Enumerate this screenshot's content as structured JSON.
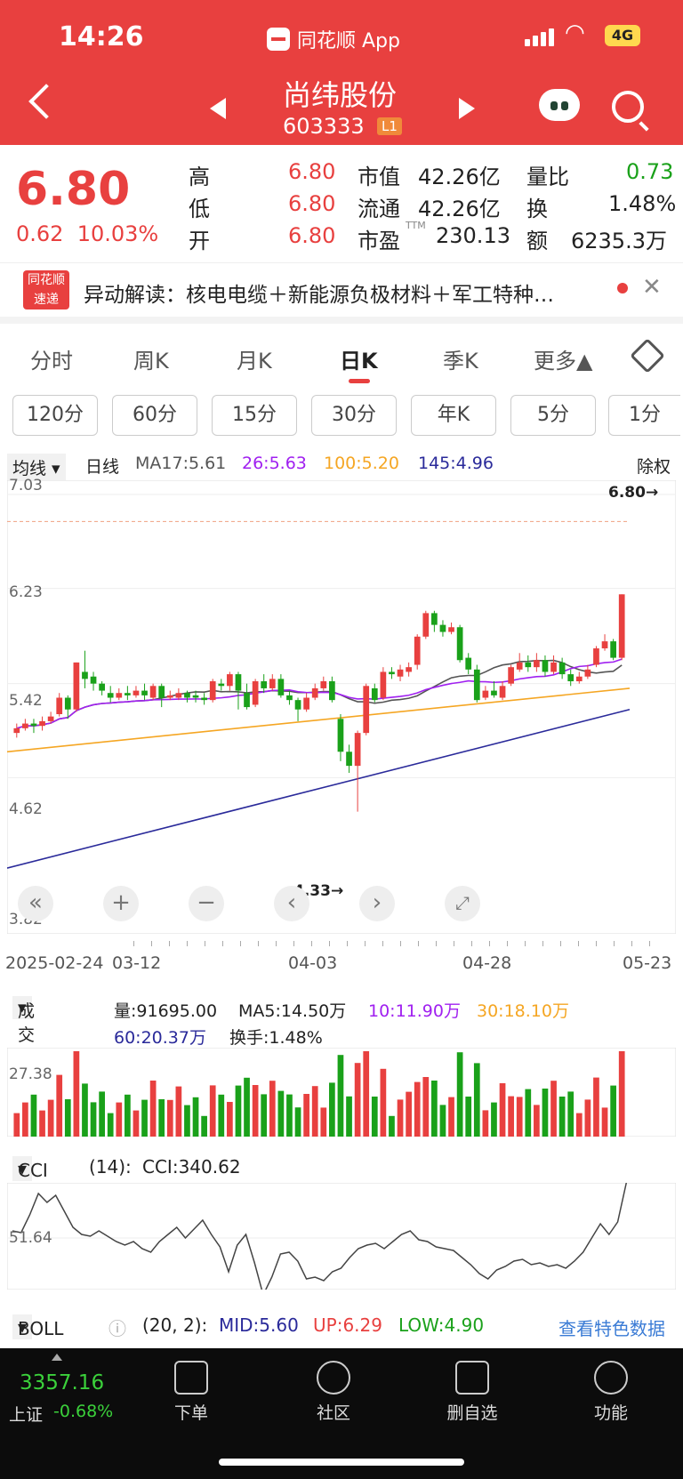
{
  "status": {
    "time": "14:26",
    "app": "同花顺 App",
    "battery": "4G"
  },
  "header": {
    "name": "尚纬股份",
    "code": "603333",
    "badge": "L1"
  },
  "quote": {
    "price": "6.80",
    "chg": "0.62",
    "chgPct": "10.03%",
    "rows": [
      {
        "l1": "高",
        "v1": "6.80",
        "l2": "市值",
        "v2": "42.26亿",
        "l3": "量比",
        "v3": "0.73"
      },
      {
        "l1": "低",
        "v1": "6.80",
        "l2": "流通",
        "v2": "42.26亿",
        "l3": "换",
        "v3": "1.48%"
      },
      {
        "l1": "开",
        "v1": "6.80",
        "l2": "市盈",
        "v2": "230.13",
        "l3": "额",
        "v3": "6235.3万"
      }
    ],
    "ttm": "TTM"
  },
  "news": {
    "logo1": "同花顺",
    "logo2": "速递",
    "text": "异动解读：核电电缆＋新能源负极材料＋军工特种…"
  },
  "tabs": [
    "分时",
    "周K",
    "月K",
    "日K",
    "季K",
    "更多▲"
  ],
  "intervals": [
    "120分",
    "60分",
    "15分",
    "30分",
    "年K",
    "5分",
    "1分"
  ],
  "ma": {
    "select": "均线",
    "type": "日线",
    "ma17": "MA17:5.61",
    "ma26": "26:5.63",
    "ma100": "100:5.20",
    "ma145": "145:4.96",
    "adjust": "除权"
  },
  "kchart": {
    "yTicks": [
      "7.03",
      "6.23",
      "5.42",
      "4.62",
      "3.82"
    ],
    "high": "6.80→",
    "low": "4.33→",
    "dates": [
      "2025-02-24",
      "03-12",
      "04-03",
      "04-28",
      "05-23"
    ]
  },
  "volume": {
    "select": "成交量",
    "vol": "量:91695.00",
    "ma5": "MA5:14.50万",
    "ma10": "10:11.90万",
    "ma30": "30:18.10万",
    "ma60": "60:20.37万",
    "turn": "换手:1.48%",
    "tick": "27.38"
  },
  "cci": {
    "select": "CCI",
    "param": "(14):",
    "value": "CCI:340.62",
    "tick": "51.64"
  },
  "boll": {
    "select": "BOLL",
    "param": "(20, 2):",
    "mid": "MID:5.60",
    "up": "UP:6.29",
    "low": "LOW:4.90",
    "link": "查看特色数据"
  },
  "bottom": {
    "index": "3357.16",
    "indexName": "上证",
    "indexChg": "-0.68%",
    "nav": [
      "下单",
      "社区",
      "删自选",
      "功能"
    ]
  },
  "colors": {
    "red": "#e8403f",
    "green": "#1aa11a",
    "purple": "#a020f0",
    "orange": "#f5a623",
    "navy": "#2a2a9a",
    "gray": "#555"
  },
  "chart_data": {
    "type": "candlestick",
    "ylim": [
      3.82,
      7.03
    ],
    "candles": [
      [
        5.0,
        5.04,
        4.96,
        5.08
      ],
      [
        5.04,
        5.08,
        5.02,
        5.12
      ],
      [
        5.08,
        5.06,
        5.0,
        5.12
      ],
      [
        5.06,
        5.1,
        5.02,
        5.14
      ],
      [
        5.1,
        5.14,
        5.08,
        5.18
      ],
      [
        5.16,
        5.3,
        5.14,
        5.34
      ],
      [
        5.3,
        5.2,
        5.12,
        5.32
      ],
      [
        5.2,
        5.6,
        5.18,
        5.6
      ],
      [
        5.52,
        5.46,
        5.38,
        5.7
      ],
      [
        5.48,
        5.42,
        5.36,
        5.52
      ],
      [
        5.42,
        5.36,
        5.32,
        5.44
      ],
      [
        5.34,
        5.3,
        5.26,
        5.4
      ],
      [
        5.3,
        5.34,
        5.28,
        5.38
      ],
      [
        5.34,
        5.32,
        5.28,
        5.4
      ],
      [
        5.32,
        5.36,
        5.3,
        5.4
      ],
      [
        5.36,
        5.32,
        5.28,
        5.42
      ],
      [
        5.3,
        5.4,
        5.28,
        5.42
      ],
      [
        5.4,
        5.3,
        5.22,
        5.42
      ],
      [
        5.3,
        5.32,
        5.28,
        5.36
      ],
      [
        5.3,
        5.34,
        5.28,
        5.38
      ],
      [
        5.34,
        5.3,
        5.26,
        5.36
      ],
      [
        5.32,
        5.3,
        5.26,
        5.36
      ],
      [
        5.3,
        5.28,
        5.24,
        5.34
      ],
      [
        5.28,
        5.44,
        5.26,
        5.46
      ],
      [
        5.42,
        5.4,
        5.36,
        5.46
      ],
      [
        5.4,
        5.5,
        5.36,
        5.52
      ],
      [
        5.5,
        5.36,
        5.2,
        5.52
      ],
      [
        5.34,
        5.22,
        5.2,
        5.42
      ],
      [
        5.24,
        5.44,
        5.22,
        5.46
      ],
      [
        5.44,
        5.38,
        5.34,
        5.5
      ],
      [
        5.38,
        5.46,
        5.36,
        5.5
      ],
      [
        5.46,
        5.32,
        5.3,
        5.5
      ],
      [
        5.32,
        5.28,
        5.24,
        5.36
      ],
      [
        5.28,
        5.2,
        5.1,
        5.3
      ],
      [
        5.2,
        5.3,
        5.18,
        5.34
      ],
      [
        5.3,
        5.38,
        5.28,
        5.42
      ],
      [
        5.38,
        5.44,
        5.36,
        5.48
      ],
      [
        5.44,
        5.28,
        5.26,
        5.48
      ],
      [
        5.12,
        4.84,
        4.76,
        5.16
      ],
      [
        4.84,
        4.72,
        4.66,
        4.9
      ],
      [
        4.72,
        5.0,
        4.33,
        5.02
      ],
      [
        5.0,
        5.4,
        4.98,
        5.42
      ],
      [
        5.38,
        5.28,
        5.26,
        5.42
      ],
      [
        5.3,
        5.52,
        5.28,
        5.56
      ],
      [
        5.52,
        5.5,
        5.46,
        5.56
      ],
      [
        5.48,
        5.54,
        5.44,
        5.58
      ],
      [
        5.52,
        5.56,
        5.48,
        5.6
      ],
      [
        5.58,
        5.82,
        5.54,
        5.84
      ],
      [
        5.82,
        6.02,
        5.8,
        6.04
      ],
      [
        6.02,
        5.92,
        5.86,
        6.04
      ],
      [
        5.92,
        5.86,
        5.82,
        5.96
      ],
      [
        5.86,
        5.9,
        5.84,
        5.94
      ],
      [
        5.9,
        5.62,
        5.6,
        5.92
      ],
      [
        5.64,
        5.54,
        5.5,
        5.68
      ],
      [
        5.54,
        5.28,
        5.26,
        5.58
      ],
      [
        5.3,
        5.36,
        5.28,
        5.4
      ],
      [
        5.36,
        5.32,
        5.3,
        5.44
      ],
      [
        5.3,
        5.4,
        5.28,
        5.44
      ],
      [
        5.42,
        5.56,
        5.4,
        5.58
      ],
      [
        5.54,
        5.6,
        5.52,
        5.68
      ],
      [
        5.6,
        5.56,
        5.52,
        5.66
      ],
      [
        5.56,
        5.62,
        5.52,
        5.68
      ],
      [
        5.62,
        5.52,
        5.48,
        5.66
      ],
      [
        5.52,
        5.6,
        5.5,
        5.66
      ],
      [
        5.6,
        5.5,
        5.46,
        5.64
      ],
      [
        5.5,
        5.44,
        5.4,
        5.54
      ],
      [
        5.44,
        5.48,
        5.42,
        5.52
      ],
      [
        5.48,
        5.54,
        5.46,
        5.58
      ],
      [
        5.58,
        5.72,
        5.56,
        5.74
      ],
      [
        5.72,
        5.78,
        5.7,
        5.84
      ],
      [
        5.78,
        5.64,
        5.62,
        5.8
      ],
      [
        5.64,
        6.18,
        5.62,
        6.18
      ]
    ]
  }
}
